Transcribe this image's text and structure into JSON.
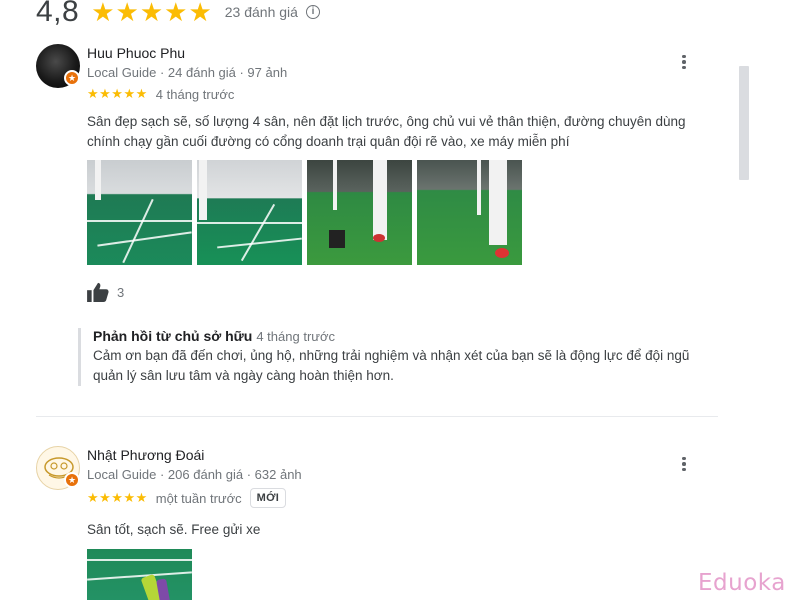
{
  "summary": {
    "rating": "4,8",
    "stars": "★★★★★",
    "count": "23 đánh giá",
    "info_icon": "ⓘ"
  },
  "reviews": [
    {
      "name": "Huu Phuoc Phu",
      "meta": "Local Guide · 24 đánh giá · 97 ảnh",
      "stars": "★★★★★",
      "time": "4 tháng trước",
      "text": "Sân đẹp sạch sẽ, số lượng 4 sân, nên đặt lịch trước, ông chủ vui vẻ thân thiện, đường chuyên dùng chính chạy gần cuối đường có cổng doanh trại quân đội rẽ vào, xe máy miễn phí",
      "likes": "3",
      "photo_count": 4,
      "owner_reply": {
        "title": "Phản hồi từ chủ sở hữu",
        "time": "4 tháng trước",
        "text": "Cảm ơn bạn đã đến chơi, ủng hộ, những trải nghiệm và nhận xét của bạn sẽ là động lực để đội ngũ quản lý sân lưu tâm và ngày càng hoàn thiện hơn."
      }
    },
    {
      "name": "Nhật Phương Đoái",
      "meta": "Local Guide · 206 đánh giá · 632 ảnh",
      "stars": "★★★★★",
      "time": "một tuần trước",
      "badge": "MỚI",
      "text": "Sân tốt, sạch sẽ. Free gửi xe",
      "photo_count": 1
    }
  ],
  "watermark": "Eduoka",
  "colors": {
    "star": "#fbbc04",
    "guide_badge": "#e8710a",
    "muted_text": "#70757a"
  }
}
